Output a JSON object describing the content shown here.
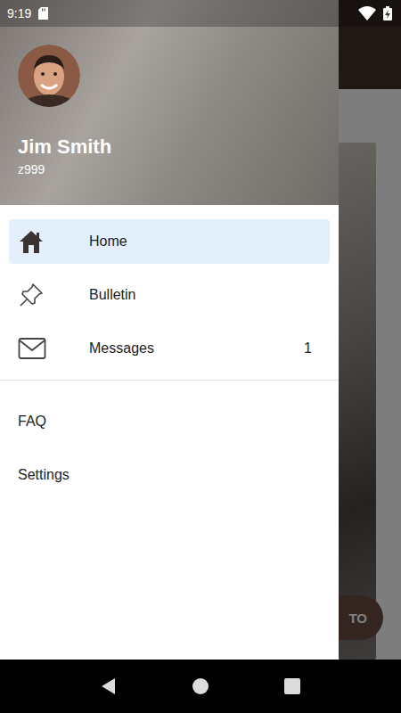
{
  "status_bar": {
    "time": "9:19"
  },
  "user": {
    "name": "Jim Smith",
    "id": "z999"
  },
  "menu": [
    {
      "label": "Home",
      "selected": true,
      "badge": "",
      "icon": "home"
    },
    {
      "label": "Bulletin",
      "selected": false,
      "badge": "",
      "icon": "pin"
    },
    {
      "label": "Messages",
      "selected": false,
      "badge": "1",
      "icon": "mail"
    }
  ],
  "secondary_menu": [
    {
      "label": "FAQ"
    },
    {
      "label": "Settings"
    }
  ],
  "background": {
    "fab_label": "TO"
  }
}
